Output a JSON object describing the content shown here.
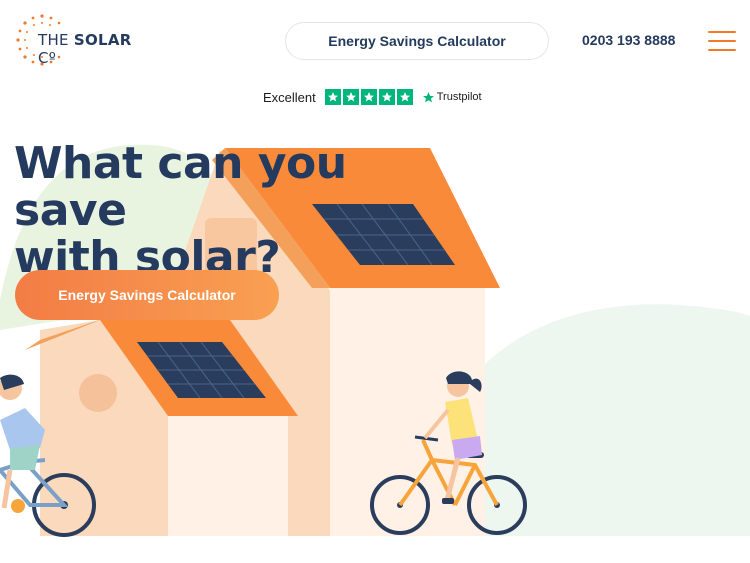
{
  "header": {
    "logo_text_plain": "THE ",
    "logo_text_bold": "SOLAR",
    "logo_text_suffix": " Cº",
    "nav_button_label": "Energy Savings Calculator",
    "phone": "0203 193 8888",
    "menu_icon": "hamburger-menu-icon"
  },
  "trustpilot": {
    "rating_label": "Excellent",
    "stars": 5,
    "brand": "Trustpilot"
  },
  "hero": {
    "headline_line1": "What can you save",
    "headline_line2": "with solar?",
    "cta_label": "Energy Savings Calculator"
  },
  "colors": {
    "brand_navy": "#243a5e",
    "accent_orange": "#f07a2c",
    "trustpilot_green": "#00b67a"
  }
}
